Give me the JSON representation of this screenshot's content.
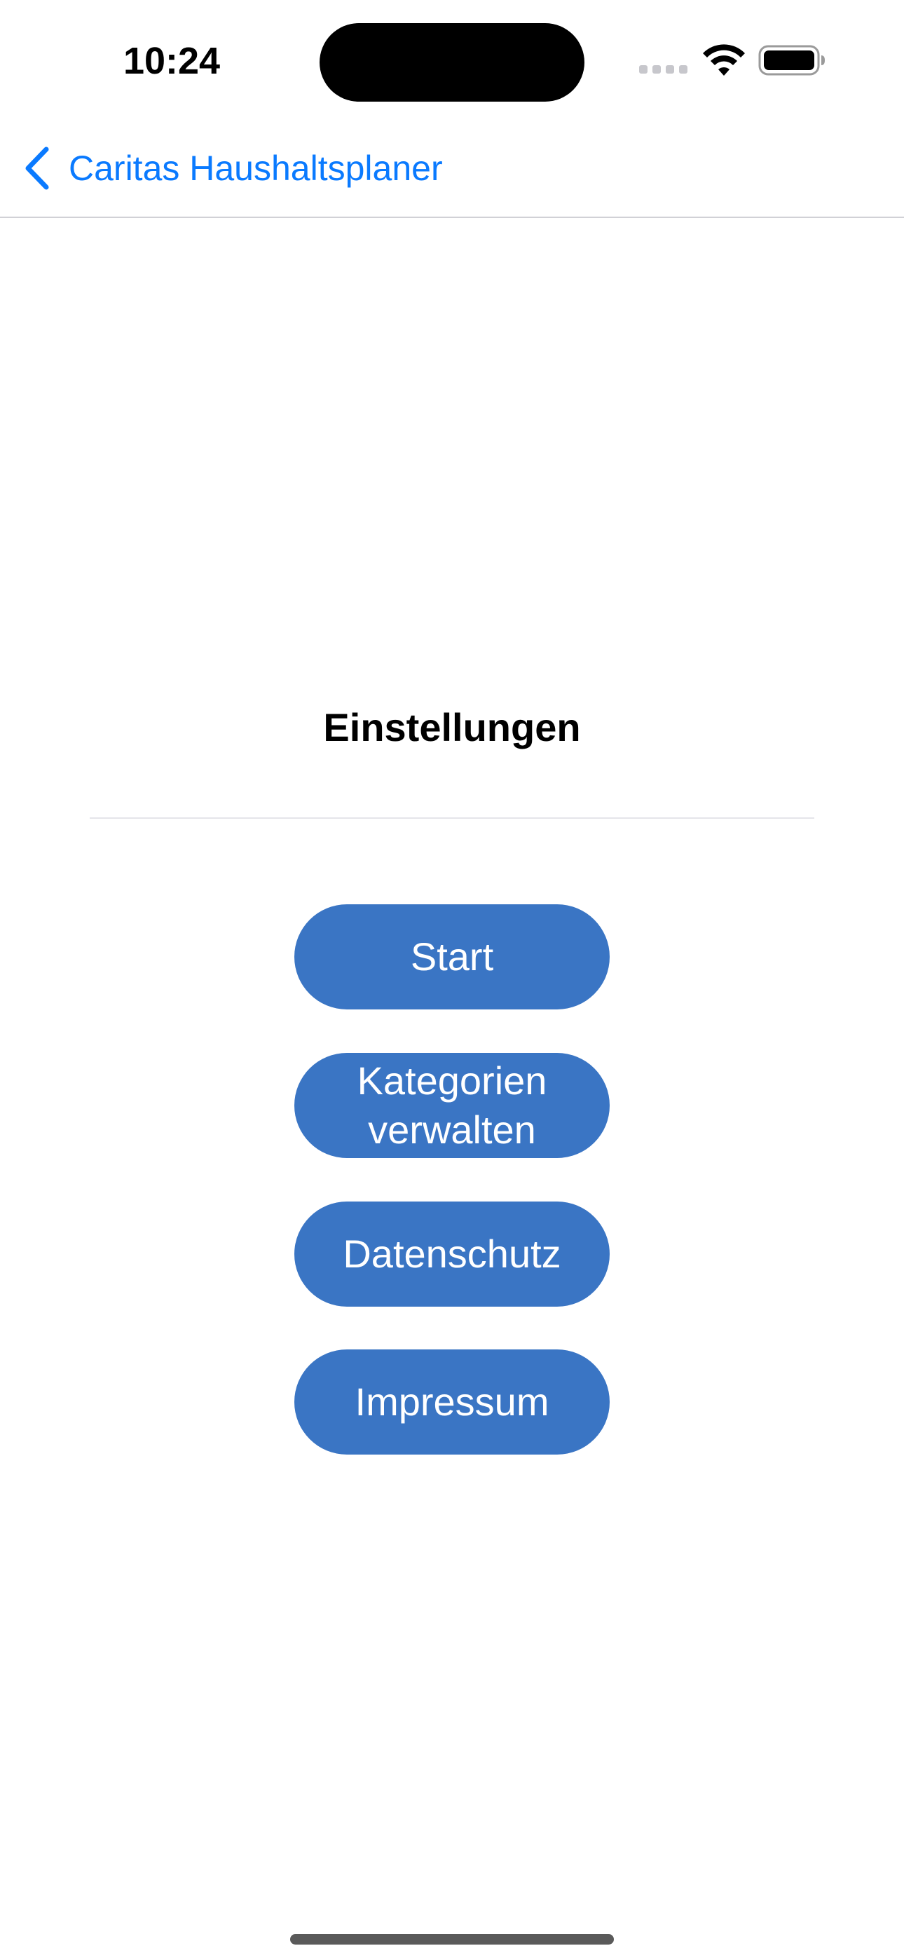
{
  "status_bar": {
    "time": "10:24",
    "wifi_icon": "wifi-icon",
    "battery_icon": "battery-icon",
    "cellular_icon": "cellular-signal-icon"
  },
  "nav_bar": {
    "back_icon": "chevron-left-icon",
    "back_label": "Caritas Haushaltsplaner"
  },
  "main": {
    "title": "Einstellungen",
    "buttons": [
      {
        "label": "Start"
      },
      {
        "label_line1": "Kategorien",
        "label_line2": "verwalten"
      },
      {
        "label": "Datenschutz"
      },
      {
        "label": "Impressum"
      }
    ]
  },
  "colors": {
    "accent": "#0a7aff",
    "button_background": "#3a75c4",
    "button_text": "#ffffff",
    "background": "#ffffff"
  }
}
